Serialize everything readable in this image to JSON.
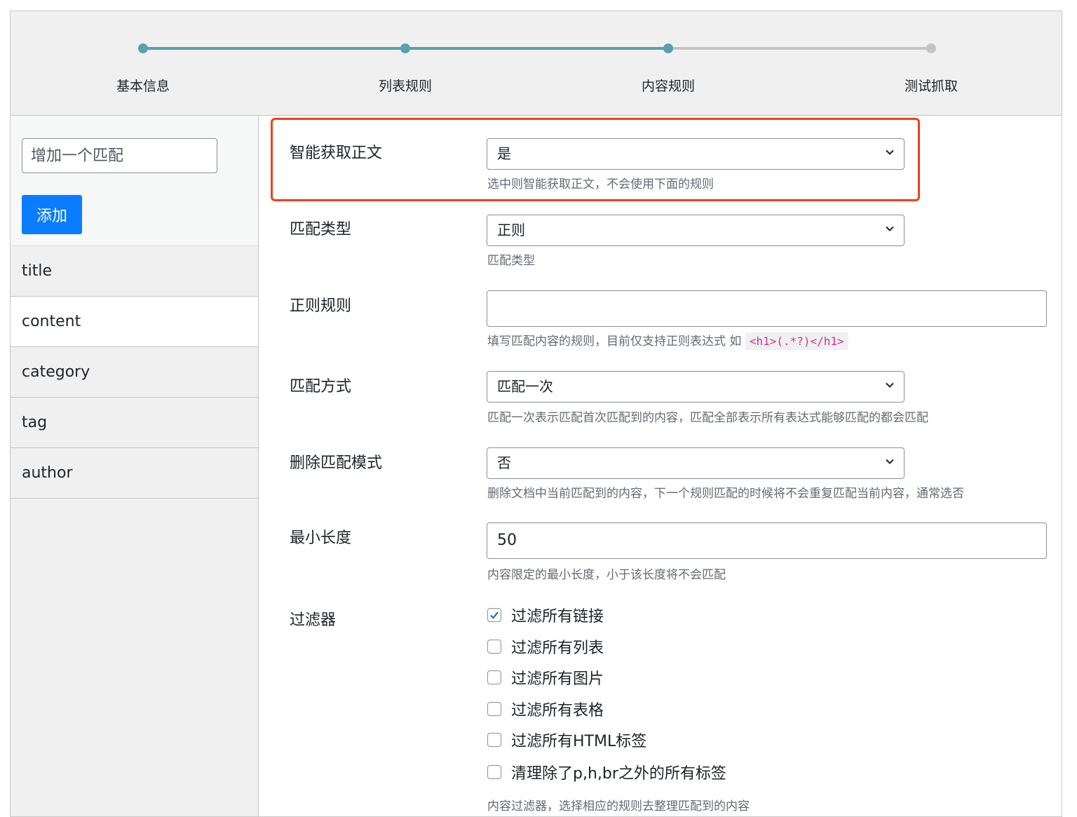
{
  "stepper": {
    "steps": [
      {
        "label": "基本信息",
        "done": true
      },
      {
        "label": "列表规则",
        "done": true
      },
      {
        "label": "内容规则",
        "done": true
      },
      {
        "label": "测试抓取",
        "done": false
      }
    ]
  },
  "sidebar": {
    "add_placeholder": "增加一个匹配",
    "add_button": "添加",
    "items": [
      "title",
      "content",
      "category",
      "tag",
      "author"
    ],
    "active_item": "content"
  },
  "form": {
    "smart_extract": {
      "label": "智能获取正文",
      "value": "是",
      "desc": "选中则智能获取正文，不会使用下面的规则"
    },
    "match_type": {
      "label": "匹配类型",
      "value": "正则",
      "desc": "匹配类型"
    },
    "regex_rule": {
      "label": "正则规则",
      "value": "",
      "desc": "填写匹配内容的规则，目前仅支持正则表达式 如",
      "example": "<h1>(.*?)</h1>"
    },
    "match_mode": {
      "label": "匹配方式",
      "value": "匹配一次",
      "desc": "匹配一次表示匹配首次匹配到的内容，匹配全部表示所有表达式能够匹配的都会匹配"
    },
    "delete_match": {
      "label": "删除匹配模式",
      "value": "否",
      "desc": "删除文档中当前匹配到的内容，下一个规则匹配的时候将不会重复匹配当前内容，通常选否"
    },
    "min_length": {
      "label": "最小长度",
      "value": "50",
      "desc": "内容限定的最小长度，小于该长度将不会匹配"
    },
    "filters": {
      "label": "过滤器",
      "options": [
        {
          "label": "过滤所有链接",
          "checked": true
        },
        {
          "label": "过滤所有列表",
          "checked": false
        },
        {
          "label": "过滤所有图片",
          "checked": false
        },
        {
          "label": "过滤所有表格",
          "checked": false
        },
        {
          "label": "过滤所有HTML标签",
          "checked": false
        },
        {
          "label": "清理除了p,h,br之外的所有标签",
          "checked": false
        }
      ],
      "desc": "内容过滤器，选择相应的规则去整理匹配到的内容"
    }
  },
  "colors": {
    "accent": "#0a7cff",
    "step_done": "#5aa0ae",
    "highlight_border": "#f0401b",
    "code_text": "#d63384"
  }
}
